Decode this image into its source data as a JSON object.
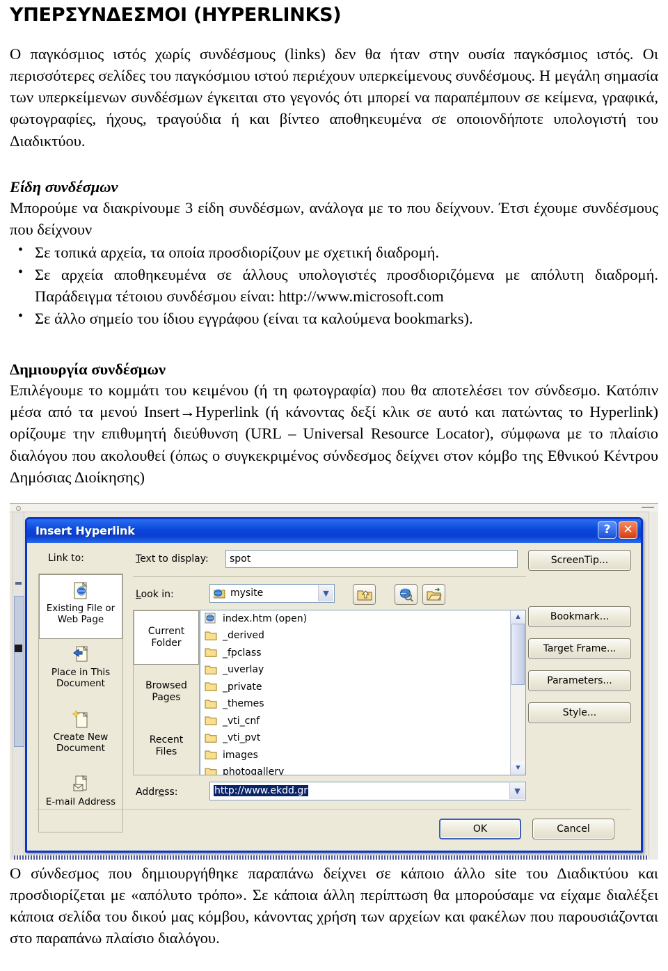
{
  "document": {
    "title": "ΥΠΕΡΣΥΝΔΕΣΜΟΙ (HYPERLINKS)",
    "intro_paragraph": "Ο παγκόσμιος ιστός χωρίς συνδέσμους (links) δεν θα ήταν στην ουσία παγκόσμιος ιστός. Οι περισσότερες σελίδες του παγκόσμιου ιστού περιέχουν υπερκείμενους συνδέσμους. Η μεγάλη σημασία των υπερκείμενων συνδέσμων έγκειται στο γεγονός ότι μπορεί να παραπέμπουν σε κείμενα, γραφικά, φωτογραφίες, ήχους, τραγούδια ή και βίντεο αποθηκευμένα σε οποιονδήποτε υπολογιστή του Διαδικτύου.",
    "section_types_heading": "Είδη συνδέσμων",
    "section_types_intro": "Μπορούμε να διακρίνουμε 3 είδη συνδέσμων, ανάλογα με το που δείχνουν. Έτσι έχουμε συνδέσμους που δείχνουν",
    "bullets": [
      "Σε τοπικά αρχεία, τα οποία προσδιορίζουν με σχετική διαδρομή.",
      "Σε αρχεία αποθηκευμένα σε άλλους υπολογιστές προσδιοριζόμενα με απόλυτη διαδρομή. Παράδειγμα τέτοιου συνδέσμου είναι: http://www.microsoft.com",
      "Σε άλλο σημείο του ίδιου εγγράφου (είναι τα καλούμενα bookmarks)."
    ],
    "section_create_heading": "Δημιουργία συνδέσμων",
    "section_create_body": "Επιλέγουμε το κομμάτι του κειμένου (ή τη φωτογραφία) που θα αποτελέσει τον σύνδεσμο. Κατόπιν μέσα από τα μενού Insert→Hyperlink (ή κάνοντας δεξί κλικ σε αυτό και πατώντας το Hyperlink) ορίζουμε την επιθυμητή διεύθυνση (URL – Universal Resource Locator), σύμφωνα με το πλαίσιο διαλόγου που ακολουθεί (όπως ο συγκεκριμένος σύνδεσμος δείχνει στον κόμβο της Εθνικού Κέντρου Δημόσιας Διοίκησης)",
    "closing_paragraph": "Ο σύνδεσμος που δημιουργήθηκε παραπάνω δείχνει σε κάποιο άλλο site του Διαδικτύου και προσδιορίζεται με «απόλυτο τρόπο». Σε κάποια άλλη περίπτωση θα μπορούσαμε να είχαμε διαλέξει κάποια σελίδα του δικού μας κόμβου, κάνοντας χρήση των αρχείων και φακέλων που παρουσιάζονται στο παραπάνω πλαίσιο διαλόγου."
  },
  "dialog": {
    "title": "Insert Hyperlink",
    "titlebar_buttons": {
      "help": "?",
      "close": "✕"
    },
    "link_to_label": "Link to:",
    "link_to_items": [
      {
        "label": "Existing File or\nWeb Page",
        "icon": "existing-file-web-page-icon",
        "selected": true
      },
      {
        "label": "Place in This\nDocument",
        "icon": "place-in-document-icon",
        "selected": false
      },
      {
        "label": "Create New\nDocument",
        "icon": "create-new-document-icon",
        "selected": false
      },
      {
        "label": "E-mail Address",
        "icon": "email-address-icon",
        "selected": false
      }
    ],
    "text_to_display": {
      "label": "Text to display:",
      "value": "spot"
    },
    "look_in": {
      "label": "Look in:",
      "value": "mysite",
      "icon": "globe-folder-icon"
    },
    "toolbar_buttons": [
      {
        "name": "up-one-folder-icon",
        "title": "Up One Folder"
      },
      {
        "name": "browse-the-web-icon",
        "title": "Browse the Web"
      },
      {
        "name": "browse-for-file-icon",
        "title": "Browse for File"
      }
    ],
    "sub_rail_items": [
      {
        "label": "Current\nFolder",
        "selected": true
      },
      {
        "label": "Browsed\nPages",
        "selected": false
      },
      {
        "label": "Recent\nFiles",
        "selected": false
      }
    ],
    "file_list": [
      {
        "name": "index.htm (open)",
        "type": "page"
      },
      {
        "name": "_derived",
        "type": "folder"
      },
      {
        "name": "_fpclass",
        "type": "folder"
      },
      {
        "name": "_uverlay",
        "type": "folder"
      },
      {
        "name": "_private",
        "type": "folder"
      },
      {
        "name": "_themes",
        "type": "folder"
      },
      {
        "name": "_vti_cnf",
        "type": "folder"
      },
      {
        "name": "_vti_pvt",
        "type": "folder"
      },
      {
        "name": "images",
        "type": "folder"
      },
      {
        "name": "photogallery",
        "type": "folder"
      }
    ],
    "address": {
      "label": "Address:",
      "value": "http://www.ekdd.gr",
      "selected": true
    },
    "side_buttons": [
      {
        "label": "ScreenTip...",
        "name": "screentip-button"
      },
      {
        "label": "Bookmark...",
        "name": "bookmark-button"
      },
      {
        "label": "Target Frame...",
        "name": "target-frame-button"
      },
      {
        "label": "Parameters...",
        "name": "parameters-button"
      },
      {
        "label": "Style...",
        "name": "style-button"
      }
    ],
    "footer_buttons": [
      {
        "label": "OK",
        "name": "ok-button",
        "default": true
      },
      {
        "label": "Cancel",
        "name": "cancel-button",
        "default": false
      }
    ]
  },
  "colors": {
    "dialog_border": "#0a36c8",
    "titlebar": "#0a46dc",
    "dialog_face": "#ece9d8",
    "selection": "#0a246a",
    "close_button": "#d63c12"
  }
}
